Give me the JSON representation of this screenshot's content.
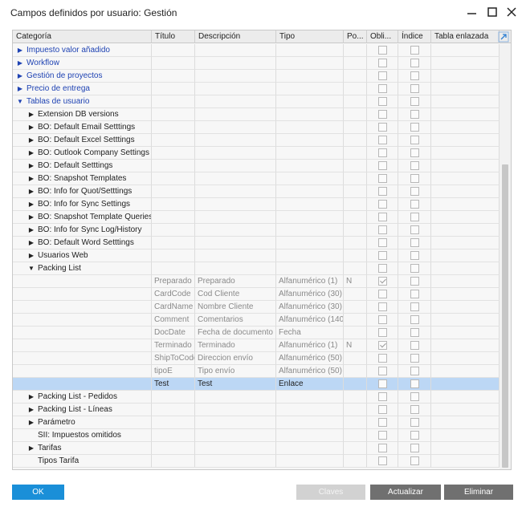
{
  "window": {
    "title": "Campos definidos por usuario: Gestión"
  },
  "grid": {
    "columns": [
      "Categoría",
      "Título",
      "Descripción",
      "Tipo",
      "Po...",
      "Obli...",
      "Índice",
      "Tabla enlazada"
    ],
    "rows": [
      {
        "level": 0,
        "expander": "collapsed",
        "category": "Impuesto valor añadido",
        "link": true,
        "title": "",
        "description": "",
        "type": "",
        "pos": "",
        "mandatory": false,
        "index": false,
        "linked_table": "",
        "dim": false
      },
      {
        "level": 0,
        "expander": "collapsed",
        "category": "Workflow",
        "link": true,
        "title": "",
        "description": "",
        "type": "",
        "pos": "",
        "mandatory": false,
        "index": false,
        "linked_table": "",
        "dim": false
      },
      {
        "level": 0,
        "expander": "collapsed",
        "category": "Gestión de proyectos",
        "link": true,
        "title": "",
        "description": "",
        "type": "",
        "pos": "",
        "mandatory": false,
        "index": false,
        "linked_table": "",
        "dim": false
      },
      {
        "level": 0,
        "expander": "collapsed",
        "category": "Precio de entrega",
        "link": true,
        "title": "",
        "description": "",
        "type": "",
        "pos": "",
        "mandatory": false,
        "index": false,
        "linked_table": "",
        "dim": false
      },
      {
        "level": 0,
        "expander": "expanded",
        "category": "Tablas de usuario",
        "link": true,
        "title": "",
        "description": "",
        "type": "",
        "pos": "",
        "mandatory": false,
        "index": false,
        "linked_table": "",
        "dim": false
      },
      {
        "level": 1,
        "expander": "collapsed",
        "category": "Extension DB versions",
        "link": false,
        "title": "",
        "description": "",
        "type": "",
        "pos": "",
        "mandatory": false,
        "index": false,
        "linked_table": "",
        "dim": false
      },
      {
        "level": 1,
        "expander": "collapsed",
        "category": "BO: Default Email Setttings",
        "link": false,
        "title": "",
        "description": "",
        "type": "",
        "pos": "",
        "mandatory": false,
        "index": false,
        "linked_table": "",
        "dim": false
      },
      {
        "level": 1,
        "expander": "collapsed",
        "category": "BO: Default Excel Setttings",
        "link": false,
        "title": "",
        "description": "",
        "type": "",
        "pos": "",
        "mandatory": false,
        "index": false,
        "linked_table": "",
        "dim": false
      },
      {
        "level": 1,
        "expander": "collapsed",
        "category": "BO: Outlook Company Settings",
        "link": false,
        "title": "",
        "description": "",
        "type": "",
        "pos": "",
        "mandatory": false,
        "index": false,
        "linked_table": "",
        "dim": false
      },
      {
        "level": 1,
        "expander": "collapsed",
        "category": "BO: Default Setttings",
        "link": false,
        "title": "",
        "description": "",
        "type": "",
        "pos": "",
        "mandatory": false,
        "index": false,
        "linked_table": "",
        "dim": false
      },
      {
        "level": 1,
        "expander": "collapsed",
        "category": "BO: Snapshot Templates",
        "link": false,
        "title": "",
        "description": "",
        "type": "",
        "pos": "",
        "mandatory": false,
        "index": false,
        "linked_table": "",
        "dim": false
      },
      {
        "level": 1,
        "expander": "collapsed",
        "category": "BO: Info for Quot/Setttings",
        "link": false,
        "title": "",
        "description": "",
        "type": "",
        "pos": "",
        "mandatory": false,
        "index": false,
        "linked_table": "",
        "dim": false
      },
      {
        "level": 1,
        "expander": "collapsed",
        "category": "BO: Info for Sync Settings",
        "link": false,
        "title": "",
        "description": "",
        "type": "",
        "pos": "",
        "mandatory": false,
        "index": false,
        "linked_table": "",
        "dim": false
      },
      {
        "level": 1,
        "expander": "collapsed",
        "category": "BO: Snapshot Template Queries",
        "link": false,
        "title": "",
        "description": "",
        "type": "",
        "pos": "",
        "mandatory": false,
        "index": false,
        "linked_table": "",
        "dim": false
      },
      {
        "level": 1,
        "expander": "collapsed",
        "category": "BO: Info for Sync Log/History",
        "link": false,
        "title": "",
        "description": "",
        "type": "",
        "pos": "",
        "mandatory": false,
        "index": false,
        "linked_table": "",
        "dim": false
      },
      {
        "level": 1,
        "expander": "collapsed",
        "category": "BO: Default Word Setttings",
        "link": false,
        "title": "",
        "description": "",
        "type": "",
        "pos": "",
        "mandatory": false,
        "index": false,
        "linked_table": "",
        "dim": false
      },
      {
        "level": 1,
        "expander": "collapsed",
        "category": "Usuarios Web",
        "link": false,
        "title": "",
        "description": "",
        "type": "",
        "pos": "",
        "mandatory": false,
        "index": false,
        "linked_table": "",
        "dim": false
      },
      {
        "level": 1,
        "expander": "expanded",
        "category": "Packing List",
        "link": false,
        "title": "",
        "description": "",
        "type": "",
        "pos": "",
        "mandatory": false,
        "index": false,
        "linked_table": "",
        "dim": false
      },
      {
        "level": 2,
        "expander": "none",
        "category": "",
        "link": false,
        "title": "Preparado",
        "description": "Preparado",
        "type": "Alfanumérico (1)",
        "pos": "N",
        "mandatory": true,
        "index": false,
        "linked_table": "",
        "dim": true
      },
      {
        "level": 2,
        "expander": "none",
        "category": "",
        "link": false,
        "title": "CardCode",
        "description": "Cod Cliente",
        "type": "Alfanumérico (30)",
        "pos": "",
        "mandatory": false,
        "index": false,
        "linked_table": "",
        "dim": true
      },
      {
        "level": 2,
        "expander": "none",
        "category": "",
        "link": false,
        "title": "CardName",
        "description": "Nombre Cliente",
        "type": "Alfanumérico (30)",
        "pos": "",
        "mandatory": false,
        "index": false,
        "linked_table": "",
        "dim": true
      },
      {
        "level": 2,
        "expander": "none",
        "category": "",
        "link": false,
        "title": "Comment",
        "description": "Comentarios",
        "type": "Alfanumérico (140)",
        "pos": "",
        "mandatory": false,
        "index": false,
        "linked_table": "",
        "dim": true
      },
      {
        "level": 2,
        "expander": "none",
        "category": "",
        "link": false,
        "title": "DocDate",
        "description": "Fecha de documento",
        "type": "Fecha",
        "pos": "",
        "mandatory": false,
        "index": false,
        "linked_table": "",
        "dim": true
      },
      {
        "level": 2,
        "expander": "none",
        "category": "",
        "link": false,
        "title": "Terminado",
        "description": "Terminado",
        "type": "Alfanumérico (1)",
        "pos": "N",
        "mandatory": true,
        "index": false,
        "linked_table": "",
        "dim": true
      },
      {
        "level": 2,
        "expander": "none",
        "category": "",
        "link": false,
        "title": "ShipToCode",
        "description": "Direccion envío",
        "type": "Alfanumérico (50)",
        "pos": "",
        "mandatory": false,
        "index": false,
        "linked_table": "",
        "dim": true
      },
      {
        "level": 2,
        "expander": "none",
        "category": "",
        "link": false,
        "title": "tipoE",
        "description": "Tipo envío",
        "type": "Alfanumérico (50)",
        "pos": "",
        "mandatory": false,
        "index": false,
        "linked_table": "",
        "dim": true
      },
      {
        "level": 2,
        "expander": "none",
        "category": "",
        "link": false,
        "title": "Test",
        "description": "Test",
        "type": "Enlace",
        "pos": "",
        "mandatory": false,
        "index": false,
        "linked_table": "",
        "dim": false,
        "selected": true
      },
      {
        "level": 1,
        "expander": "collapsed",
        "category": "Packing List - Pedidos",
        "link": false,
        "title": "",
        "description": "",
        "type": "",
        "pos": "",
        "mandatory": false,
        "index": false,
        "linked_table": "",
        "dim": false
      },
      {
        "level": 1,
        "expander": "collapsed",
        "category": "Packing List - Líneas",
        "link": false,
        "title": "",
        "description": "",
        "type": "",
        "pos": "",
        "mandatory": false,
        "index": false,
        "linked_table": "",
        "dim": false
      },
      {
        "level": 1,
        "expander": "collapsed",
        "category": "Parámetro",
        "link": false,
        "title": "",
        "description": "",
        "type": "",
        "pos": "",
        "mandatory": false,
        "index": false,
        "linked_table": "",
        "dim": false
      },
      {
        "level": 1,
        "expander": "none",
        "category": "SII: Impuestos omitidos",
        "link": false,
        "title": "",
        "description": "",
        "type": "",
        "pos": "",
        "mandatory": false,
        "index": false,
        "linked_table": "",
        "dim": false
      },
      {
        "level": 1,
        "expander": "collapsed",
        "category": "Tarifas",
        "link": false,
        "title": "",
        "description": "",
        "type": "",
        "pos": "",
        "mandatory": false,
        "index": false,
        "linked_table": "",
        "dim": false
      },
      {
        "level": 1,
        "expander": "none",
        "category": "Tipos Tarifa",
        "link": false,
        "title": "",
        "description": "",
        "type": "",
        "pos": "",
        "mandatory": false,
        "index": false,
        "linked_table": "",
        "dim": false
      }
    ]
  },
  "buttons": {
    "ok": "OK",
    "keys": "Claves",
    "update": "Actualizar",
    "delete": "Eliminar"
  },
  "icons": {
    "minimize": "minimize-icon",
    "maximize": "maximize-icon",
    "close": "close-icon",
    "expand_grid": "expand-arrow-icon",
    "collapsed": "triangle-right-icon",
    "expanded": "triangle-down-icon"
  },
  "colors": {
    "link": "#1f43b3",
    "selected_row": "#bcd7f5",
    "primary_button": "#1a8fd8",
    "dark_button": "#707070"
  }
}
